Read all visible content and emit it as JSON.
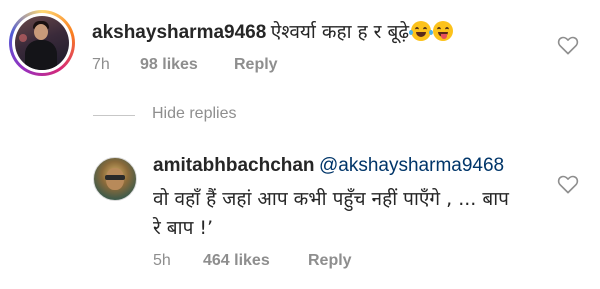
{
  "comment": {
    "username": "akshaysharma9468",
    "text": "ऐश्वर्या कहा ह र बूढ़े",
    "emojis": [
      "laughing-with-tears-emoji",
      "tongue-out-emoji"
    ],
    "time": "7h",
    "likes": "98 likes",
    "reply_label": "Reply",
    "avatar_icon": "user-avatar"
  },
  "hide_replies_label": "Hide replies",
  "reply": {
    "username": "amitabhbachchan",
    "mention": "@akshaysharma9468",
    "text_line1": "वो वहाँ हैं जहां आप कभी पहुँच नहीं पाएँगे , ... बाप",
    "text_line2": "रे बाप !’",
    "time": "5h",
    "likes": "464 likes",
    "reply_label": "Reply",
    "avatar_icon": "user-avatar"
  },
  "colors": {
    "text": "#262626",
    "muted": "#8e8e8e",
    "mention": "#003569",
    "heart_stroke": "#8e8e8e"
  },
  "icons": {
    "like": "heart-outline-icon"
  }
}
